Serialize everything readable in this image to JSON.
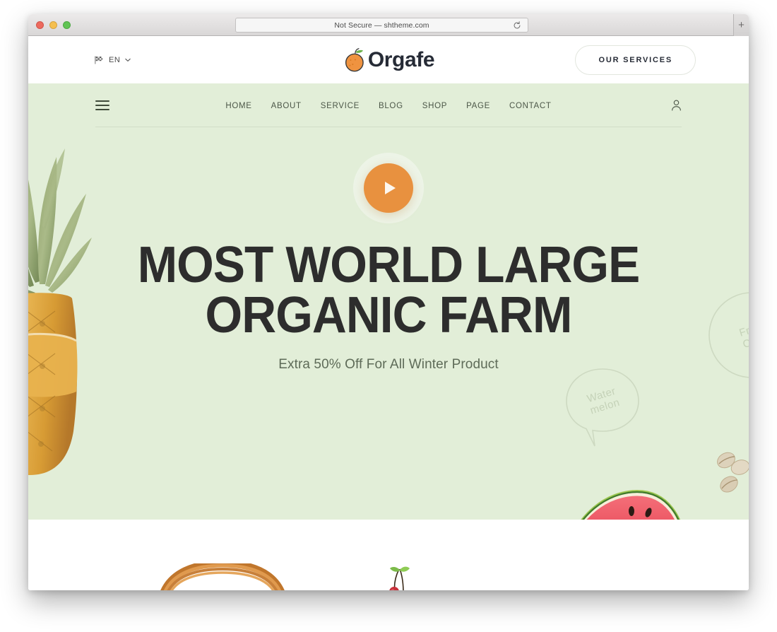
{
  "browser": {
    "url_text": "Not Secure — shtheme.com",
    "reload_label": "↻",
    "new_tab_label": "+",
    "traffic_lights": [
      "close",
      "minimize",
      "maximize"
    ]
  },
  "topbar": {
    "language": {
      "flag_icon": "flag-icon",
      "label": "EN",
      "chevron_icon": "chevron-down-icon"
    },
    "brand": {
      "mark_icon": "orange-fruit-icon",
      "name": "Orgafe"
    },
    "cta": {
      "label": "OUR SERVICES"
    }
  },
  "nav": {
    "menu_icon": "hamburger-menu-icon",
    "account_icon": "user-account-icon",
    "items": [
      {
        "label": "HOME"
      },
      {
        "label": "ABOUT"
      },
      {
        "label": "SERVICE"
      },
      {
        "label": "BLOG"
      },
      {
        "label": "SHOP"
      },
      {
        "label": "PAGE"
      },
      {
        "label": "CONTACT"
      }
    ]
  },
  "hero": {
    "play_button": {
      "icon": "play-icon",
      "label": "Play"
    },
    "title_line1": "MOST WORLD LARGE",
    "title_line2": "ORGANIC FARM",
    "subtitle": "Extra 50% Off For All Winter Product",
    "background_color": "#e2eed8",
    "accent_color": "#e8913f",
    "title_color": "#2d2d2d",
    "decorations": [
      {
        "name": "pineapple",
        "type": "photo"
      },
      {
        "name": "watermelon-slice",
        "type": "photo"
      },
      {
        "name": "pistachios",
        "type": "photo"
      }
    ],
    "bubbles": [
      {
        "name": "watermelon-bubble",
        "text": "Water\nmelon"
      },
      {
        "name": "fresh-bubble",
        "text": "Fre\nC"
      }
    ]
  },
  "below": {
    "basket_icon": "basket-handle",
    "cherry_icon": "cherry-with-leaf"
  }
}
